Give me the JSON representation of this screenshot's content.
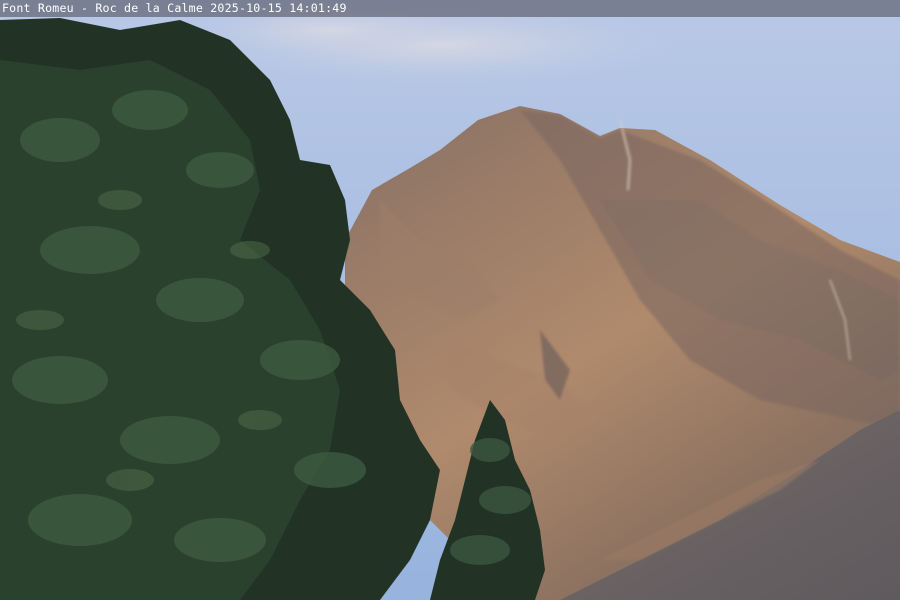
{
  "overlay": {
    "caption": "Font Romeu - Roc de la Calme 2025-10-15 14:01:49"
  },
  "colors": {
    "sky_top": "#b9c8e6",
    "sky_bottom": "#97b3de",
    "cloud": "#cfd3e0",
    "rock_light": "#b08a6c",
    "rock_mid": "#8e7361",
    "rock_shadow": "#6f6462",
    "slope_right": "#6a6264",
    "pine_dark": "#1e2d22",
    "pine_mid": "#2f4a35",
    "pine_light": "#4a6a4c"
  }
}
